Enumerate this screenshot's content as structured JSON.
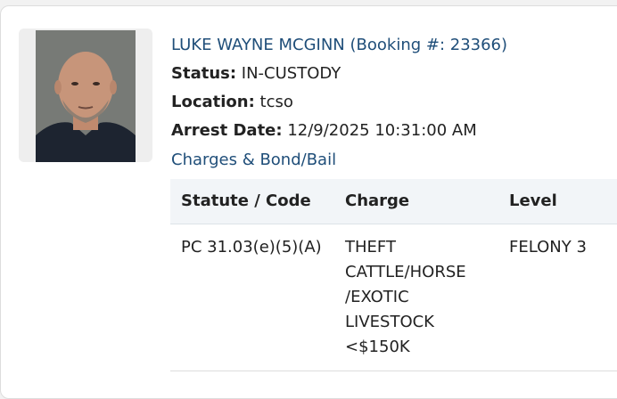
{
  "inmate": {
    "name_line": "LUKE WAYNE MCGINN (Booking #: 23366)",
    "status_label": "Status:",
    "status_value": "IN-CUSTODY",
    "location_label": "Location:",
    "location_value": "tcso",
    "arrest_label": "Arrest Date:",
    "arrest_value": "12/9/2025 10:31:00 AM"
  },
  "charges_link": "Charges & Bond/Bail",
  "table": {
    "headers": [
      "Statute / Code",
      "Charge",
      "Level"
    ],
    "rows": [
      [
        "PC 31.03(e)(5)(A)",
        "THEFT CATTLE/HORSE /EXOTIC LIVESTOCK <$150K",
        "FELONY 3"
      ]
    ]
  },
  "colors": {
    "link": "#1f4e79",
    "header_bg": "#f2f5f8"
  }
}
